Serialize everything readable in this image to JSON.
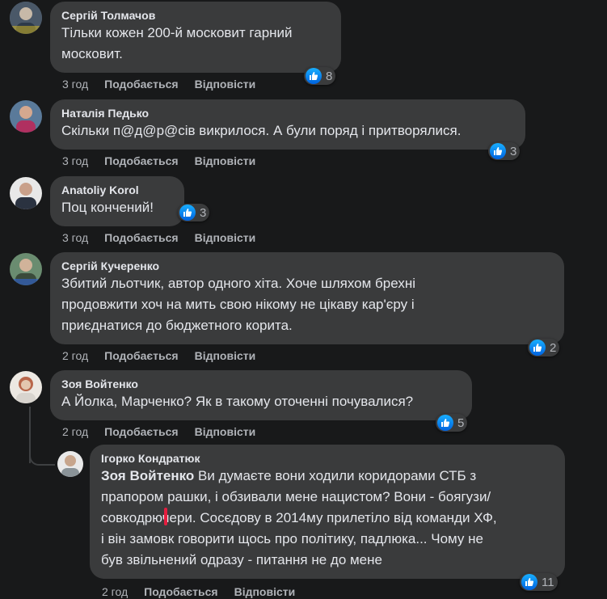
{
  "comments": [
    {
      "author": "Сергій Толмачов",
      "lines": [
        "Тільки кожен 200-й московит гарний",
        "московит."
      ],
      "time": "3 год",
      "like": "Подобається",
      "reply": "Відповісти",
      "reactions": "8",
      "colors": {
        "avatar": "#5d6b7a"
      }
    },
    {
      "author": "Наталія Педько",
      "lines": [
        "Скільки п@д@р@сів викрилося. А були поряд і притворялися."
      ],
      "time": "3 год",
      "like": "Подобається",
      "reply": "Відповісти",
      "reactions": "3",
      "colors": {
        "avatar": "#8a5a6a"
      }
    },
    {
      "author": "Anatoliy Korol",
      "lines": [
        "Поц кончений!"
      ],
      "time": "3 год",
      "like": "Подобається",
      "reply": "Відповісти",
      "reactions": "3",
      "colors": {
        "avatar": "#7b8a96"
      }
    },
    {
      "author": "Сергій Кучеренко",
      "lines": [
        "Збитий льотчик, автор одного хіта. Хоче шляхом брехні",
        "продовжити хоч на мить свою нікому не цікаву кар'єру і",
        "приєднатися до бюджетного корита."
      ],
      "time": "2 год",
      "like": "Подобається",
      "reply": "Відповісти",
      "reactions": "2",
      "colors": {
        "avatar": "#4d6b55"
      }
    },
    {
      "author": "Зоя Войтенко",
      "lines": [
        "А Йолка, Марченко? Як в такому оточенні почувалися?"
      ],
      "time": "2 год",
      "like": "Подобається",
      "reply": "Відповісти",
      "reactions": "5",
      "colors": {
        "avatar": "#c9bdb3"
      }
    }
  ],
  "reply": {
    "author": "Ігорко Кондратюк",
    "mention": "Зоя Войтенко",
    "line1_rest": " Ви думаєте вони ходили коридорами СТБ з",
    "lines": [
      "прапором рашки, і обзивали мене нацистом? Вони - боягузи/",
      "совкодрючери. Сосєдову в 2014му прилетіло від команди ХФ,",
      "і він замовк говорити щось про політику, падлюка... Чому не",
      "був звільнений одразу - питання не до мене"
    ],
    "time": "2 год",
    "like": "Подобається",
    "reply": "Відповісти",
    "reactions": "11",
    "colors": {
      "avatar": "#9aa4ab",
      "mark": "#e41e3f"
    }
  },
  "icons": {
    "like": "thumbs-up-icon"
  }
}
